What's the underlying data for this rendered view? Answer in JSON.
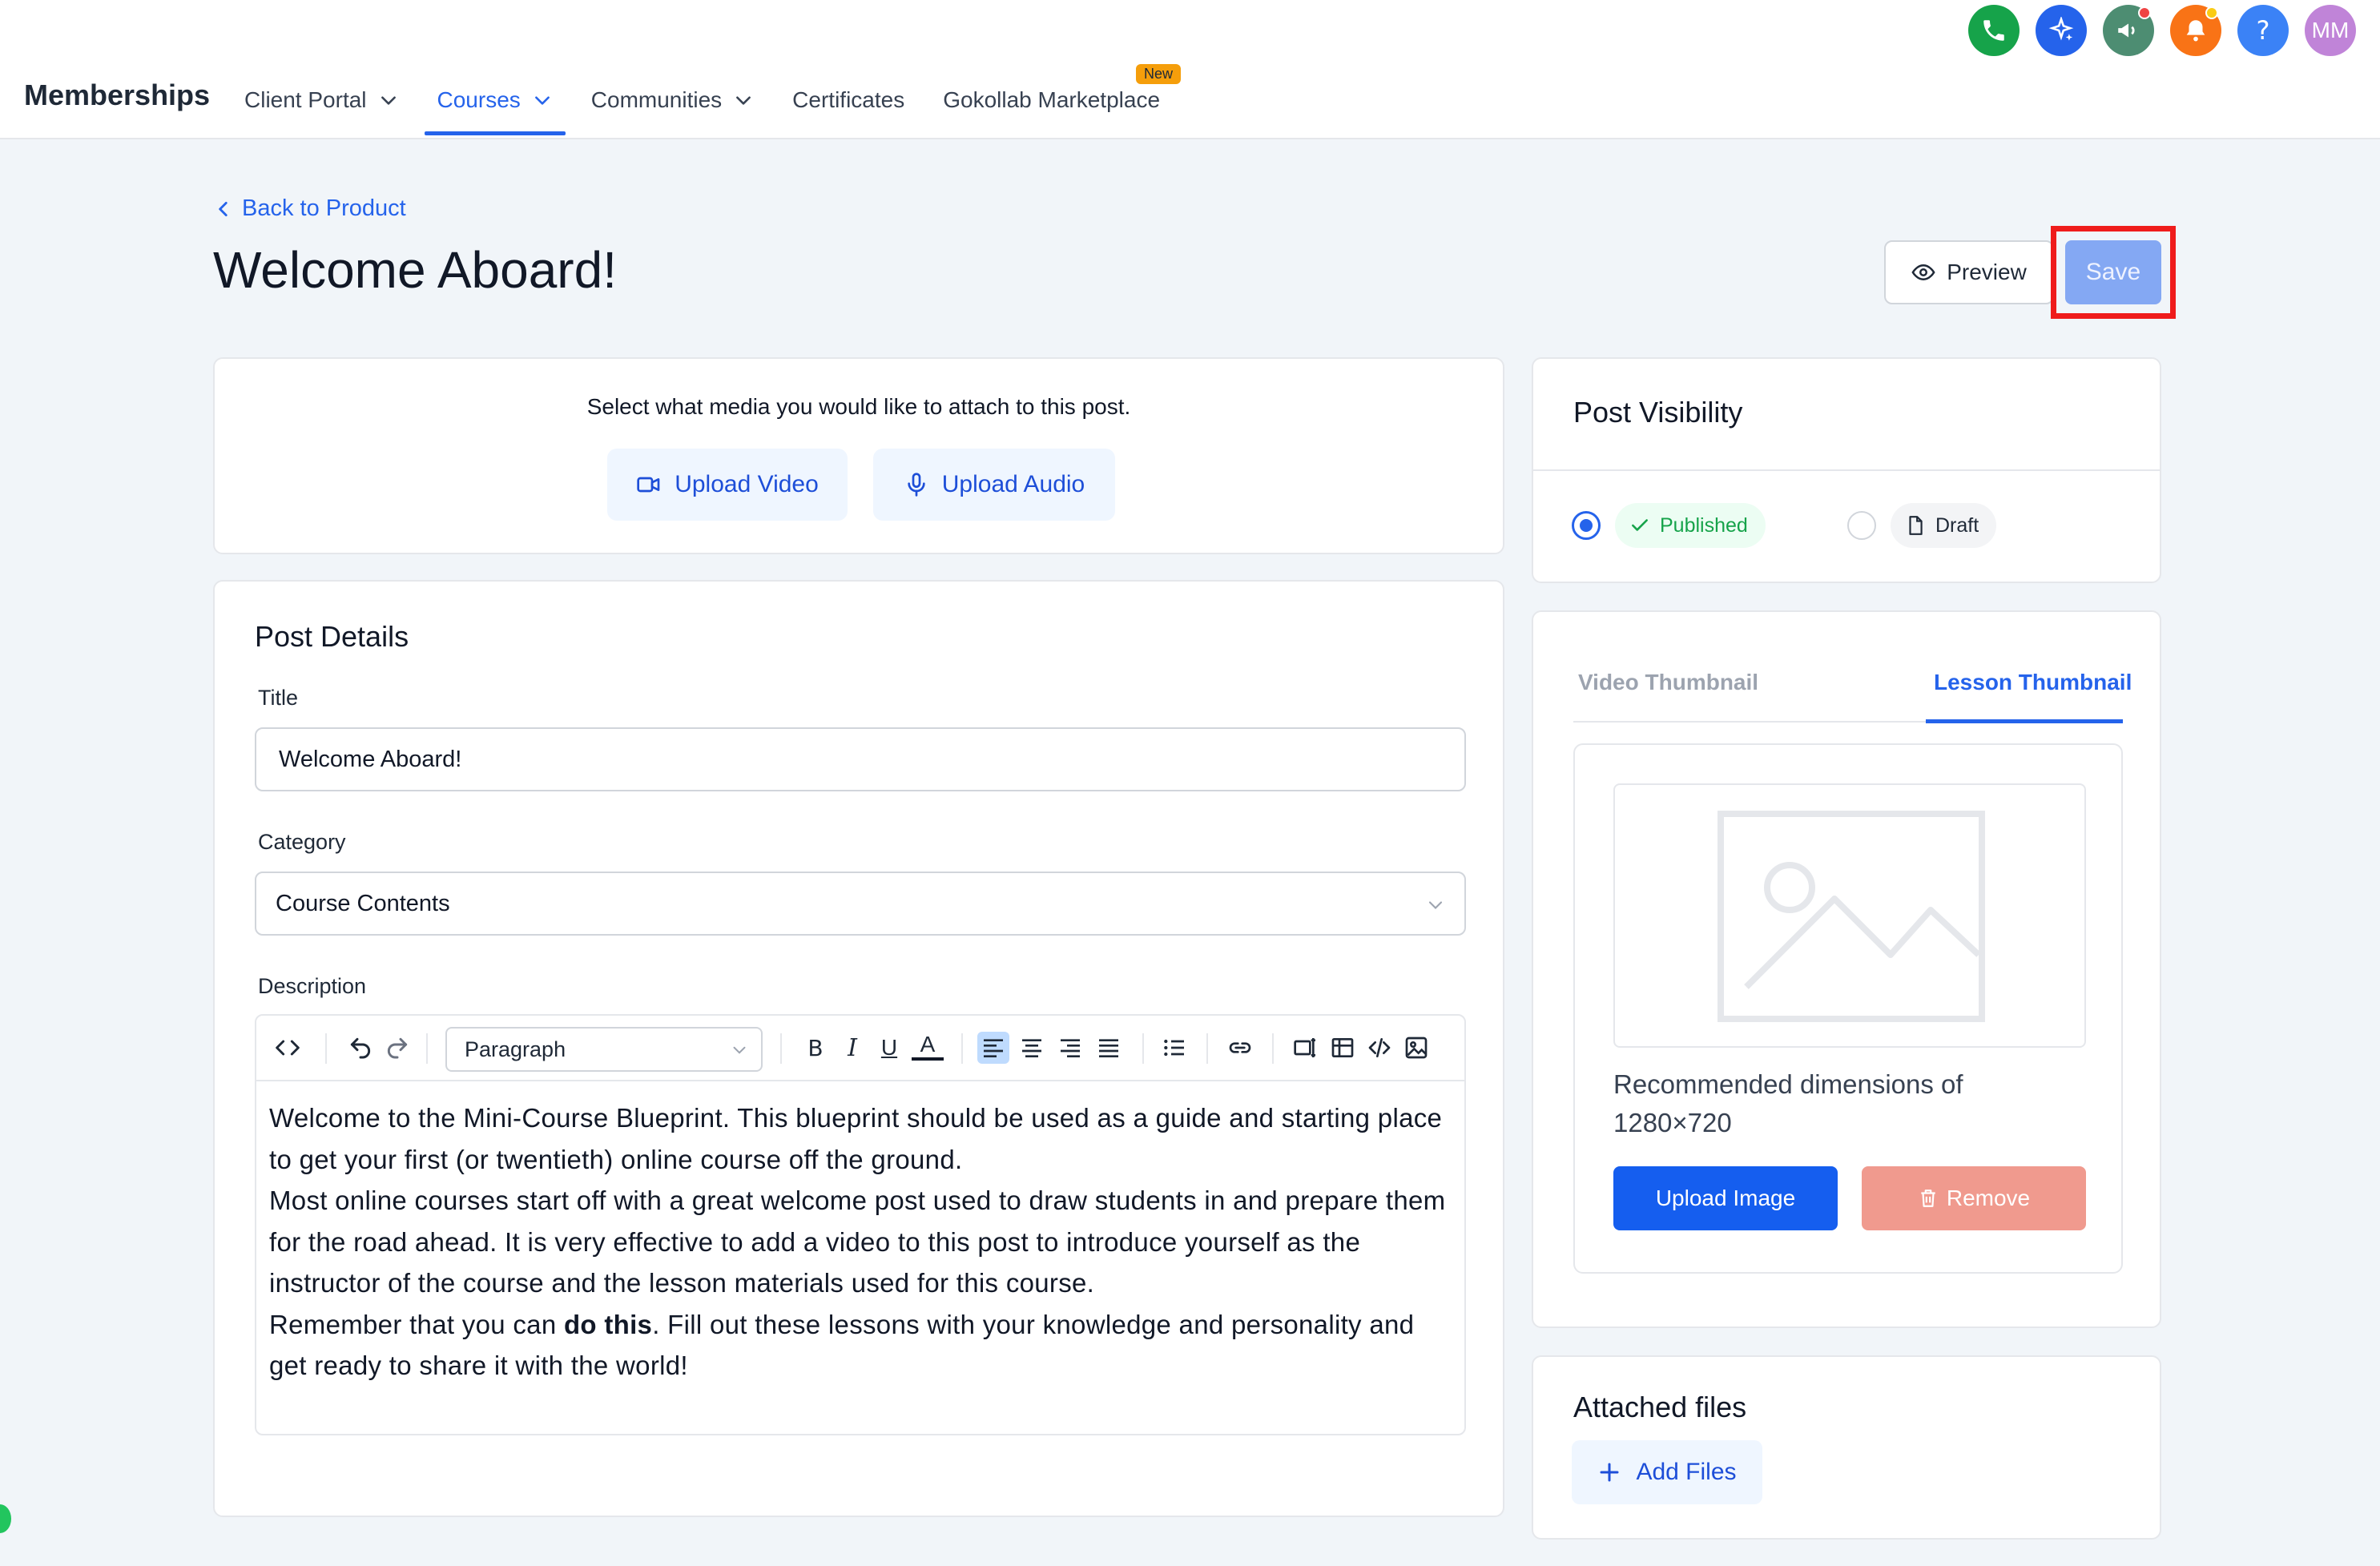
{
  "header": {
    "brand": "Memberships",
    "nav": [
      {
        "label": "Client Portal"
      },
      {
        "label": "Courses"
      },
      {
        "label": "Communities"
      },
      {
        "label": "Certificates"
      },
      {
        "label": "Gokollab Marketplace",
        "badge": "New"
      }
    ],
    "icons": [
      "phone-icon",
      "sparkle-icon",
      "megaphone-icon",
      "bell-icon",
      "help-icon"
    ],
    "avatar_initials": "MM",
    "colors": {
      "accent": "#2563eb",
      "phone": "#16a34a",
      "sparkle": "#2563eb",
      "megaphone": "#4d8d72",
      "bell": "#f97316",
      "help": "#3b82f6",
      "avatar": "#c084d8"
    }
  },
  "page": {
    "back_label": "Back to Product",
    "title": "Welcome Aboard!",
    "preview_label": "Preview",
    "save_label": "Save"
  },
  "media": {
    "prompt": "Select what media you would like to attach to this post.",
    "upload_video": "Upload Video",
    "upload_audio": "Upload Audio"
  },
  "details": {
    "heading": "Post Details",
    "title_label": "Title",
    "title_value": "Welcome Aboard!",
    "category_label": "Category",
    "category_value": "Course Contents",
    "description_label": "Description",
    "paragraph_select": "Paragraph",
    "toolbar_letters": {
      "bold": "B",
      "italic": "I",
      "underline": "U",
      "color": "A"
    },
    "body": {
      "p1": "Welcome to the Mini-Course Blueprint. This blueprint should be used as a guide and starting place to get your first (or twentieth) online course off the ground.",
      "p2": "Most online courses start off with a great welcome post used to draw students in and prepare them for the road ahead. It is very effective to add a video to this post to introduce yourself as the instructor of the course and the lesson materials used for this course.",
      "p3_start": "Remember that you can ",
      "p3_bold": "do this",
      "p3_end": ". Fill out these lessons with your knowledge and personality and get ready to share it with the world!"
    }
  },
  "visibility": {
    "heading": "Post Visibility",
    "options": [
      {
        "label": "Published",
        "selected": true
      },
      {
        "label": "Draft",
        "selected": false
      }
    ]
  },
  "thumbnail": {
    "tabs": [
      {
        "label": "Video Thumbnail",
        "active": false
      },
      {
        "label": "Lesson Thumbnail",
        "active": true
      }
    ],
    "recommended": "Recommended dimensions of 1280×720",
    "upload_label": "Upload Image",
    "remove_label": "Remove"
  },
  "files": {
    "heading": "Attached files",
    "add_label": "Add Files"
  }
}
